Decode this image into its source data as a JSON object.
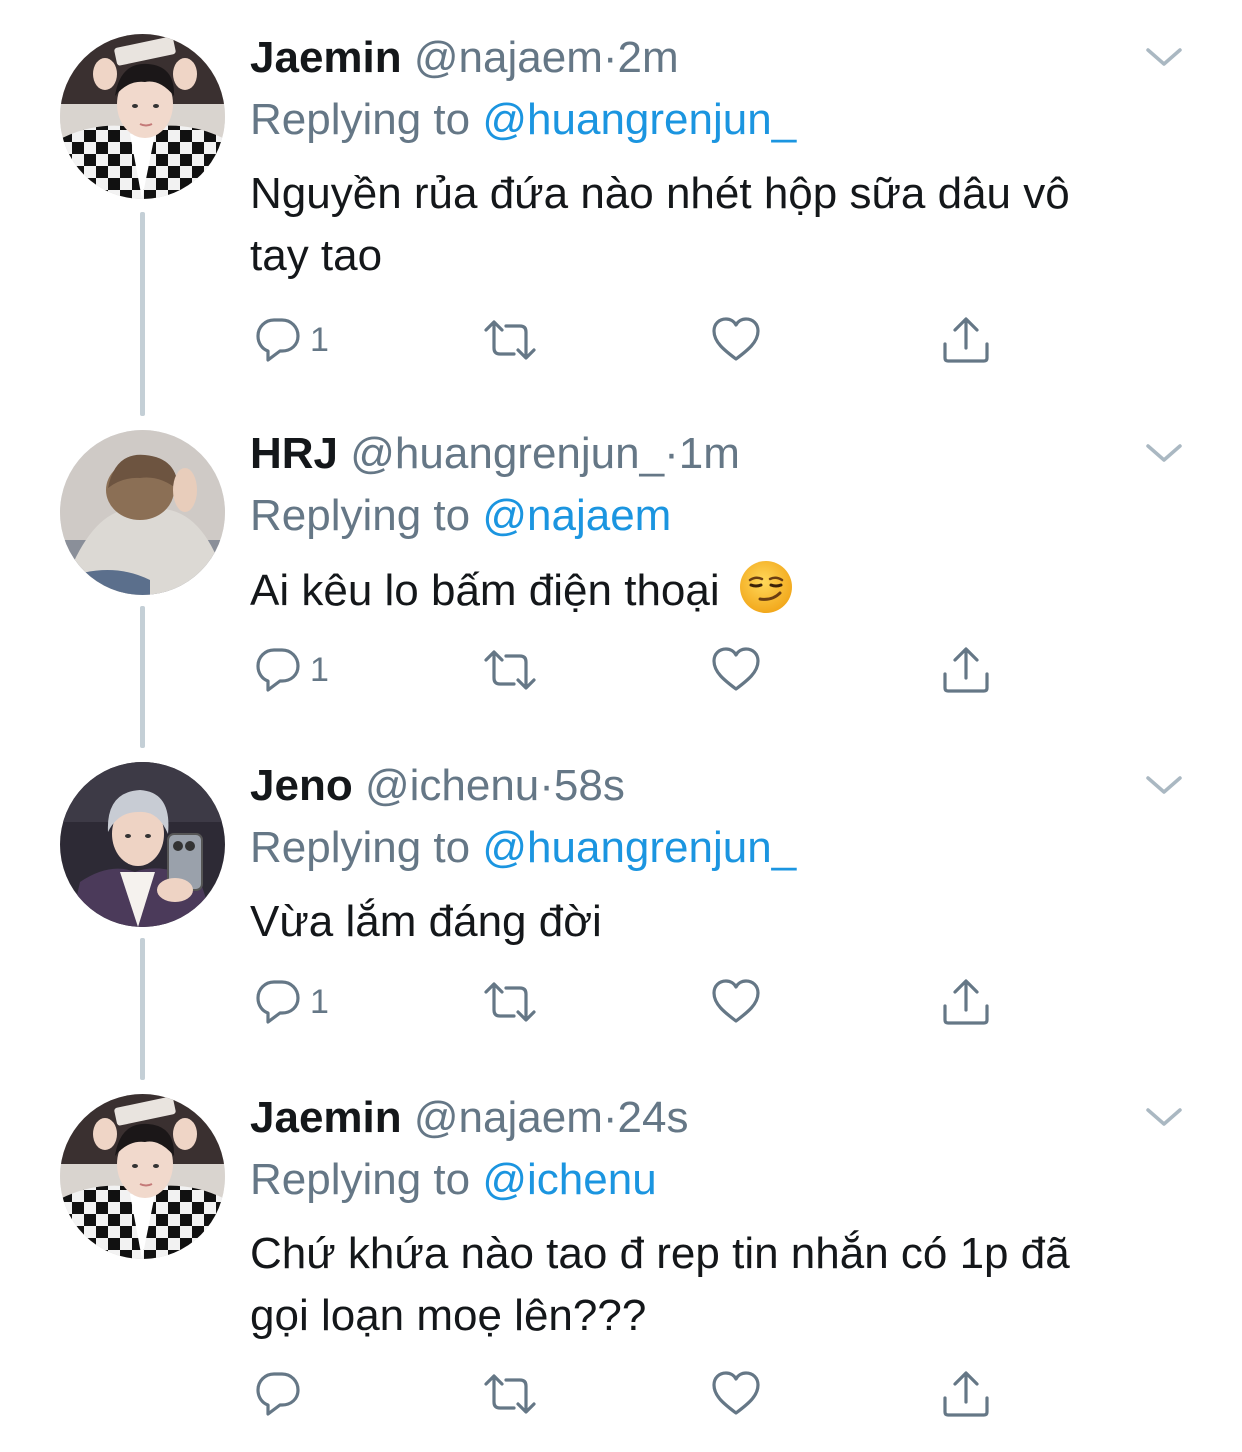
{
  "colors": {
    "name": "#14171a",
    "secondary": "#657786",
    "mention": "#1b95e0",
    "thread_line": "#c4cfd6"
  },
  "tweets": [
    {
      "name": "Jaemin",
      "handle": "@najaem",
      "dot": "·",
      "time": "2m",
      "replying_prefix": "Replying to ",
      "replying_to": "@huangrenjun_",
      "text_line1": "Nguyền rủa đứa nào nhét hộp sữa dâu vô",
      "text_line2": "tay tao",
      "reply_count": "1",
      "avatar": "avatar-jaemin"
    },
    {
      "name": "HRJ",
      "handle": "@huangrenjun_",
      "dot": "·",
      "time": "1m",
      "replying_prefix": "Replying to ",
      "replying_to": "@najaem",
      "text_line1": "Ai kêu lo bấm điện thoại",
      "emoji": "smirking-face-emoji",
      "reply_count": "1",
      "avatar": "avatar-hrj"
    },
    {
      "name": "Jeno",
      "handle": "@ichenu",
      "dot": "·",
      "time": "58s",
      "replying_prefix": "Replying to ",
      "replying_to": "@huangrenjun_",
      "text_line1": "Vừa lắm đáng đời",
      "reply_count": "1",
      "avatar": "avatar-jeno"
    },
    {
      "name": "Jaemin",
      "handle": "@najaem",
      "dot": "·",
      "time": "24s",
      "replying_prefix": "Replying to ",
      "replying_to": "@ichenu",
      "text_line1": "Chứ khứa nào tao đ rep tin nhắn có 1p đã",
      "text_line2": "gọi loạn moẹ lên???",
      "reply_count": "",
      "avatar": "avatar-jaemin"
    }
  ],
  "icons": {
    "reply": "reply-icon",
    "retweet": "retweet-icon",
    "like": "like-icon",
    "share": "share-icon",
    "caret": "chevron-down-icon"
  }
}
